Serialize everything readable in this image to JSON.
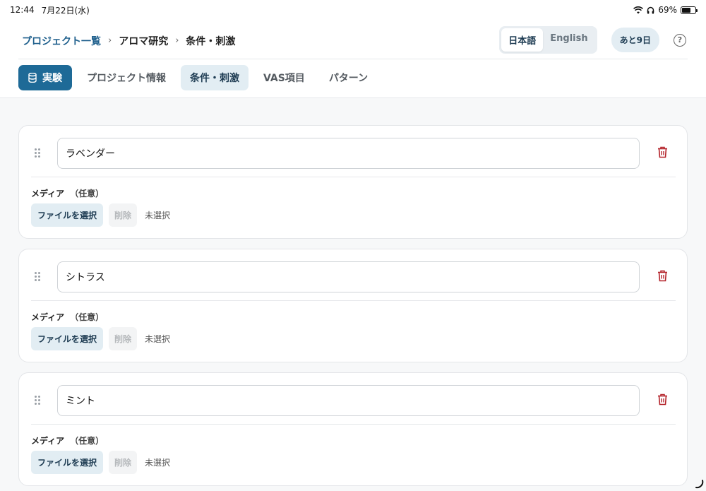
{
  "status": {
    "time": "12:44",
    "date": "7月22日(水)",
    "battery": "69%",
    "battery_level": 0.69
  },
  "breadcrumb": {
    "root": "プロジェクト一覧",
    "project": "アロマ研究",
    "current": "条件・刺激"
  },
  "language": {
    "ja": "日本語",
    "en": "English",
    "active": "ja"
  },
  "days_left": "あと9日",
  "help": "?",
  "tabs": [
    {
      "label": "実験",
      "icon": "database-icon"
    },
    {
      "label": "プロジェクト情報"
    },
    {
      "label": "条件・刺激"
    },
    {
      "label": "VAS項目"
    },
    {
      "label": "パターン"
    }
  ],
  "conditions": [
    {
      "name": "ラベンダー"
    },
    {
      "name": "シトラス"
    },
    {
      "name": "ミント"
    }
  ],
  "media": {
    "label": "メディア",
    "optional": "（任意）",
    "choose_file": "ファイルを選択",
    "delete": "削除",
    "none_selected": "未選択"
  },
  "colors": {
    "primary": "#1e6a97",
    "accent_light": "#e2edf3",
    "danger": "#b4232a"
  }
}
